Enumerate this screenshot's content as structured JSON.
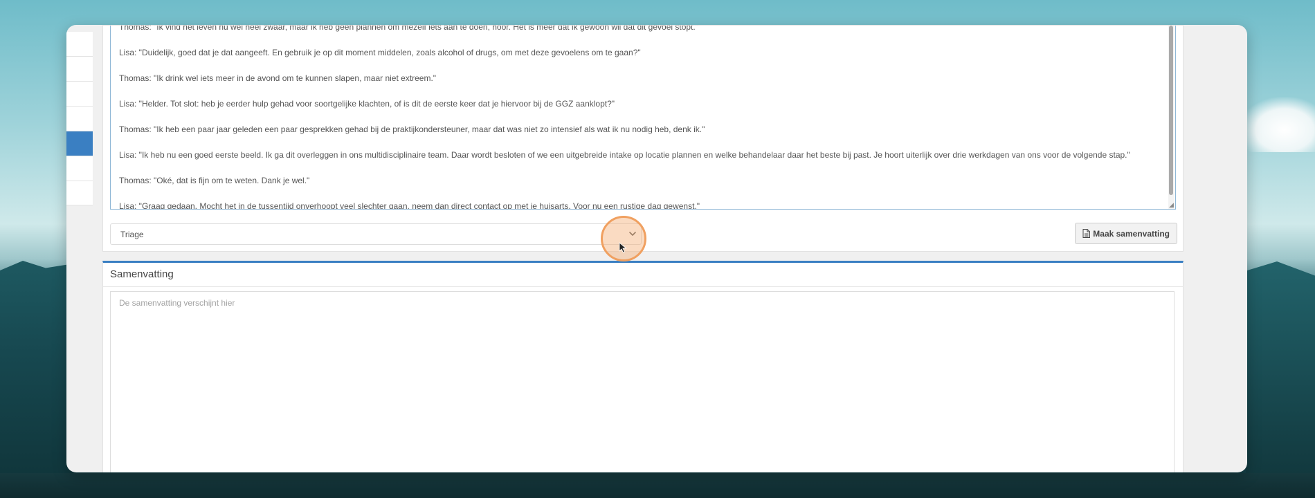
{
  "transcript": {
    "lines": [
      "Thomas: \"Ik vind het leven nu wel heel zwaar, maar ik heb geen plannen om mezelf iets aan te doen, hoor. Het is meer dat ik gewoon wil dat dit gevoel stopt.\"",
      "Lisa: \"Duidelijk, goed dat je dat aangeeft. En gebruik je op dit moment middelen, zoals alcohol of drugs, om met deze gevoelens om te gaan?\"",
      "Thomas: \"Ik drink wel iets meer in de avond om te kunnen slapen, maar niet extreem.\"",
      "Lisa: \"Helder. Tot slot: heb je eerder hulp gehad voor soortgelijke klachten, of is dit de eerste keer dat je hiervoor bij de GGZ aanklopt?\"",
      "Thomas: \"Ik heb een paar jaar geleden een paar gesprekken gehad bij de praktijkondersteuner, maar dat was niet zo intensief als wat ik nu nodig heb, denk ik.\"",
      "Lisa: \"Ik heb nu een goed eerste beeld. Ik ga dit overleggen in ons multidisciplinaire team. Daar wordt besloten of we een uitgebreide intake op locatie plannen en welke behandelaar daar het beste bij past. Je hoort uiterlijk over drie werkdagen van ons voor de volgende stap.\"",
      "Thomas: \"Oké, dat is fijn om te weten. Dank je wel.\"",
      "Lisa: \"Graag gedaan. Mocht het in de tussentijd onverhoopt veel slechter gaan, neem dan direct contact op met je huisarts. Voor nu een rustige dag gewenst.\""
    ]
  },
  "controls": {
    "template_select_value": "Triage",
    "summary_button_label": "Maak samenvatting",
    "summary_button_icon": "document-icon"
  },
  "summary": {
    "heading": "Samenvatting",
    "placeholder": "De samenvatting verschijnt hier"
  },
  "colors": {
    "accent": "#3a7fc2",
    "cursor_highlight": "#f0a060"
  }
}
